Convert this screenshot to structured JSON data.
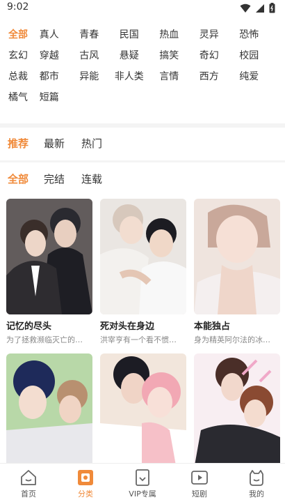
{
  "status": {
    "time": "9:02"
  },
  "genres": [
    [
      "全部",
      "真人",
      "青春",
      "民国",
      "热血",
      "灵异",
      "恐怖"
    ],
    [
      "玄幻",
      "穿越",
      "古风",
      "悬疑",
      "搞笑",
      "奇幻",
      "校园"
    ],
    [
      "总裁",
      "都市",
      "异能",
      "非人类",
      "言情",
      "西方",
      "纯爱"
    ],
    [
      "橘气",
      "短篇"
    ]
  ],
  "sort_filters": [
    "推荐",
    "最新",
    "热门"
  ],
  "status_filters": [
    "全部",
    "完结",
    "连载"
  ],
  "comics": [
    {
      "title": "记忆的尽头",
      "desc": "为了拯救濒临灭亡的…"
    },
    {
      "title": "死对头在身边",
      "desc": "洪宰亨有一个看不惯…"
    },
    {
      "title": "本能独占",
      "desc": "身为精英阿尔法的冰…"
    },
    {
      "title": "",
      "desc": ""
    },
    {
      "title": "",
      "desc": ""
    },
    {
      "title": "",
      "desc": ""
    }
  ],
  "nav": [
    "首页",
    "分类",
    "VIP专属",
    "短剧",
    "我的"
  ],
  "colors": {
    "accent": "#f08a3a",
    "text": "#333333",
    "muted": "#888888"
  }
}
